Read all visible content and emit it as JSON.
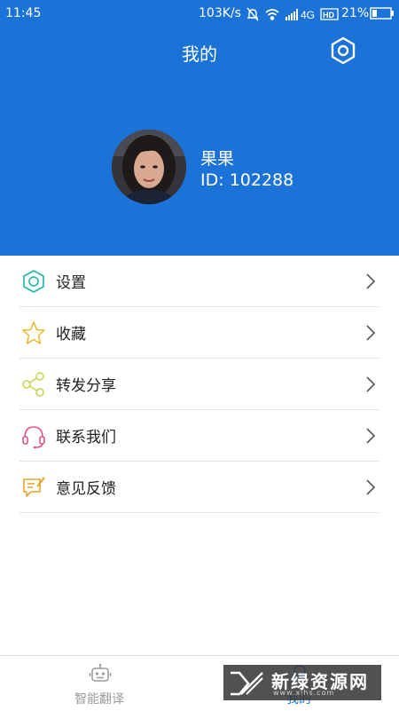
{
  "status_bar": {
    "time": "11:45",
    "net_speed": "103K/s",
    "network": "4G",
    "hd": "HD",
    "battery": "21%"
  },
  "header": {
    "title": "我的",
    "background_color": "#1b73d8"
  },
  "profile": {
    "name": "果果",
    "id_label": "ID:",
    "id_value": "102288"
  },
  "menu": {
    "items": [
      {
        "label": "设置",
        "icon": "gear-icon",
        "color": "#1fb5a8"
      },
      {
        "label": "收藏",
        "icon": "star-icon",
        "color": "#e6b72a"
      },
      {
        "label": "转发分享",
        "icon": "share-icon",
        "color": "#c8d24a"
      },
      {
        "label": "联系我们",
        "icon": "headset-icon",
        "color": "#e2528a"
      },
      {
        "label": "意见反馈",
        "icon": "feedback-icon",
        "color": "#e6a52a"
      }
    ]
  },
  "bottom_nav": {
    "items": [
      {
        "label": "智能翻译",
        "icon": "robot-icon",
        "active": false
      },
      {
        "label": "我的",
        "icon": "person-icon",
        "active": true
      }
    ]
  },
  "watermark": {
    "text": "新绿资源网",
    "url": "www.xlhs.com"
  }
}
